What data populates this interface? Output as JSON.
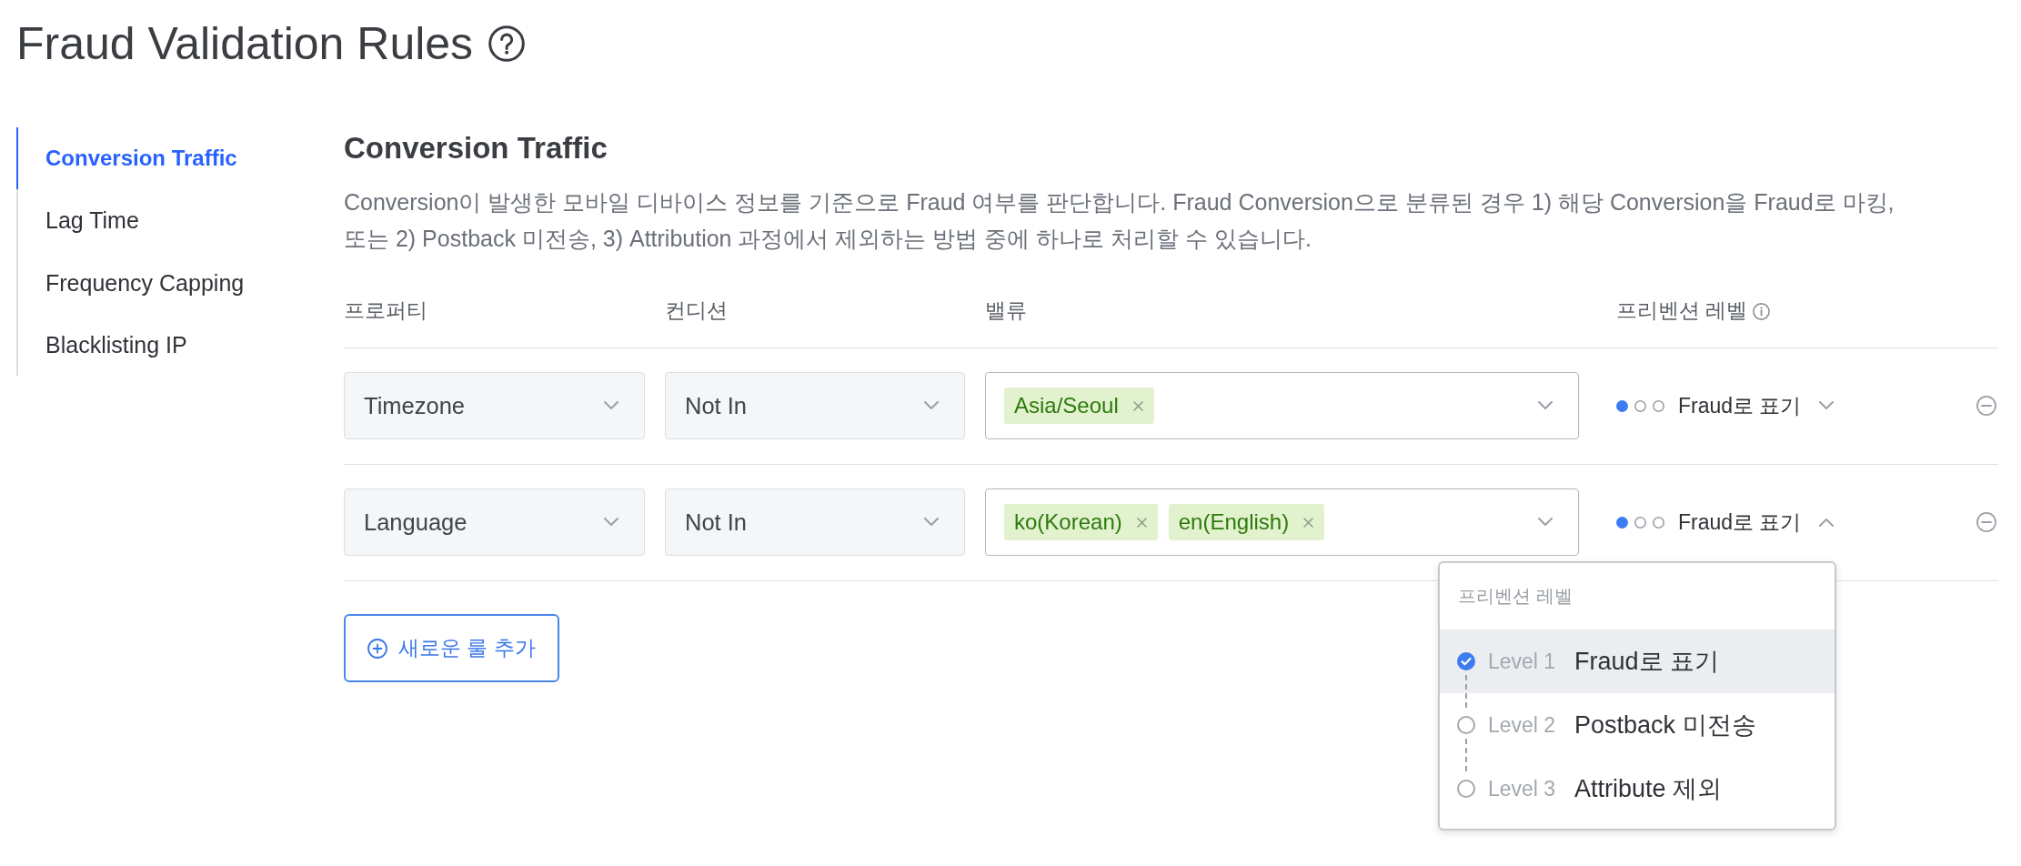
{
  "page": {
    "title": "Fraud Validation Rules"
  },
  "sidebar": {
    "items": [
      {
        "label": "Conversion Traffic",
        "selected": true
      },
      {
        "label": "Lag Time",
        "selected": false
      },
      {
        "label": "Frequency Capping",
        "selected": false
      },
      {
        "label": "Blacklisting IP",
        "selected": false
      }
    ]
  },
  "section": {
    "title": "Conversion Traffic",
    "description": "Conversion이 발생한 모바일 디바이스 정보를 기준으로 Fraud 여부를 판단합니다. Fraud Conversion으로 분류된 경우 1) 해당 Conversion을 Fraud로 마킹, 또는 2) Postback 미전송, 3) Attribution 과정에서 제외하는 방법 중에 하나로 처리할 수 있습니다."
  },
  "rules_table": {
    "columns": [
      {
        "label": "프로퍼티",
        "info_icon": false
      },
      {
        "label": "컨디션",
        "info_icon": false
      },
      {
        "label": "밸류",
        "info_icon": false
      },
      {
        "label": "프리벤션 레벨",
        "info_icon": true
      }
    ],
    "rows": [
      {
        "property": "Timezone",
        "condition": "Not In",
        "values": [
          "Asia/Seoul"
        ],
        "prevention": {
          "dots": [
            {
              "filled": true
            },
            {
              "filled": false
            },
            {
              "filled": false
            }
          ],
          "label": "Fraud로 표기",
          "expanded": false
        }
      },
      {
        "property": "Language",
        "condition": "Not In",
        "values": [
          "ko(Korean)",
          "en(English)"
        ],
        "prevention": {
          "dots": [
            {
              "filled": true
            },
            {
              "filled": false
            },
            {
              "filled": false
            }
          ],
          "label": "Fraud로 표기",
          "expanded": true,
          "menu": {
            "title": "프리벤션 레벨",
            "options": [
              {
                "level_label": "Level 1",
                "label": "Fraud로 표기",
                "selected": true
              },
              {
                "level_label": "Level 2",
                "label": "Postback 미전송",
                "selected": false
              },
              {
                "level_label": "Level 3",
                "label": "Attribute 제외",
                "selected": false
              }
            ]
          }
        }
      }
    ]
  },
  "add_rule_button": {
    "label": "새로운 룰 추가"
  }
}
